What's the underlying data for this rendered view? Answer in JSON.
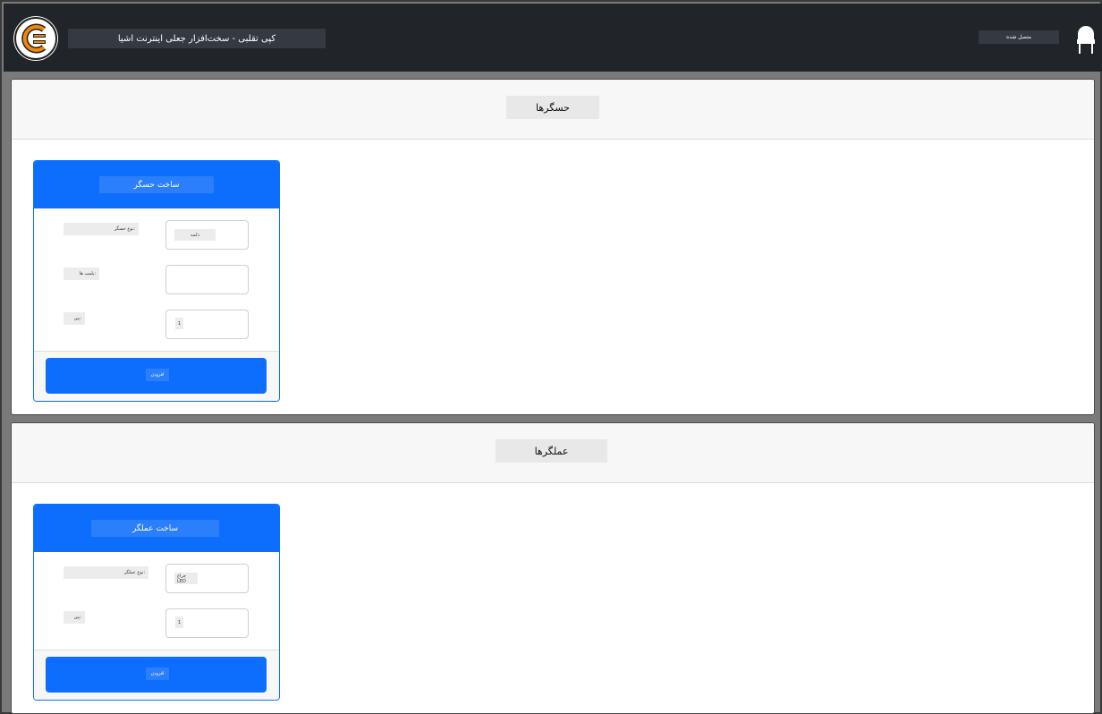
{
  "header": {
    "app_title": "کپی تقلبی - سخت‌افزار جعلی اینترنت اشیا",
    "status": "متصل شده"
  },
  "sensors": {
    "title": "حسگرها",
    "card_title": "ساخت حسگر",
    "fields": [
      {
        "label": "نوع حسگر:",
        "value": "دکمه"
      },
      {
        "label": "پلمپ ها:",
        "value": ""
      },
      {
        "label": "پین:",
        "value": "1"
      }
    ],
    "add_label": "افزودن"
  },
  "actuators": {
    "title": "عملگرها",
    "card_title": "ساخت عملگر",
    "fields": [
      {
        "label": "نوع عملگر:",
        "value": "چراغ LED"
      },
      {
        "label": "پین:",
        "value": "1"
      }
    ],
    "add_label": "افزودن"
  },
  "colors": {
    "primary": "#0d6efd",
    "navbar": "#212529",
    "logo_orange": "#f0860c"
  },
  "icons": {
    "logo": "cf-logo-icon",
    "status": "light-bulb-icon"
  }
}
